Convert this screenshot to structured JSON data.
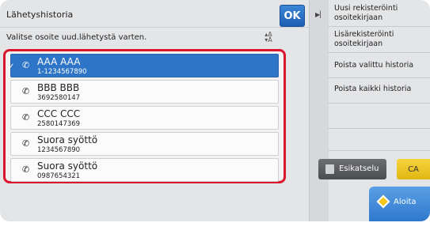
{
  "header": {
    "title": "Lähetyshistoria",
    "ok_label": "OK",
    "subtitle": "Valitse osoite uud.lähetystä varten.",
    "sort_icon": "sort-alpha-icon"
  },
  "history": [
    {
      "name": "AAA AAA",
      "number": "1-1234567890",
      "selected": true
    },
    {
      "name": "BBB BBB",
      "number": "3692580147",
      "selected": false
    },
    {
      "name": "CCC CCC",
      "number": "2580147369",
      "selected": false
    },
    {
      "name": "Suora syöttö",
      "number": "1234567890",
      "selected": false
    },
    {
      "name": "Suora syöttö",
      "number": "0987654321",
      "selected": false
    }
  ],
  "menu": {
    "items": [
      {
        "label": "Uusi rekisteröinti osoitekirjaan"
      },
      {
        "label": "Lisärekisteröinti osoitekirjaan"
      },
      {
        "label": "Poista valittu historia"
      },
      {
        "label": "Poista kaikki historia"
      }
    ]
  },
  "actions": {
    "preview_label": "Esikatselu",
    "ca_label": "CA",
    "start_label": "Aloita"
  },
  "colors": {
    "selection": "#2e75c8",
    "highlight_frame": "#d9162b",
    "ok_button": "#2a6fc4",
    "ca_button": "#f0c72a",
    "start_button": "#3f88d6"
  }
}
